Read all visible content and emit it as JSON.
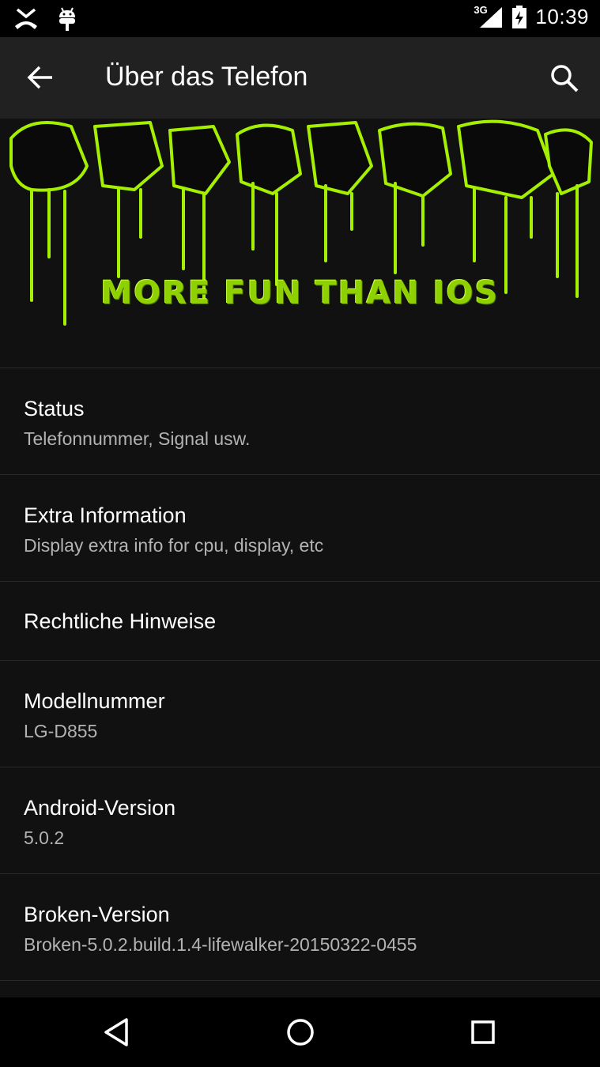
{
  "status_bar": {
    "network": "3G",
    "time": "10:39",
    "icons": [
      "missed-call-icon",
      "android-icon",
      "signal-icon",
      "battery-charging-icon"
    ]
  },
  "toolbar": {
    "title": "Über das Telefon",
    "back_icon": "arrow-back-icon",
    "search_icon": "search-icon"
  },
  "banner": {
    "tagline": "MORE FUN THAN IOS",
    "accent_color": "#8fd100"
  },
  "items": [
    {
      "title": "Status",
      "summary": "Telefonnummer, Signal usw."
    },
    {
      "title": "Extra Information",
      "summary": "Display extra info for cpu, display, etc"
    },
    {
      "title": "Rechtliche Hinweise",
      "summary": ""
    },
    {
      "title": "Modellnummer",
      "summary": "LG-D855"
    },
    {
      "title": "Android-Version",
      "summary": "5.0.2"
    },
    {
      "title": "Broken-Version",
      "summary": "Broken-5.0.2.build.1.4-lifewalker-20150322-0455"
    }
  ],
  "nav_bar": {
    "icons": [
      "back-triangle-icon",
      "home-circle-icon",
      "recents-square-icon"
    ]
  }
}
